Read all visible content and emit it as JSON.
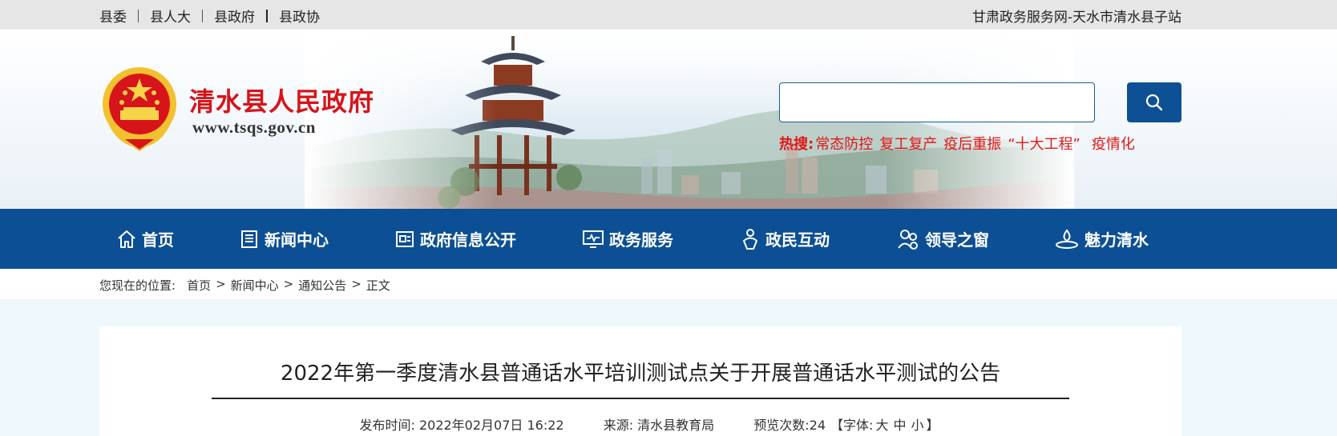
{
  "topbar": {
    "links": [
      "县委",
      "县人大",
      "县政府",
      "县政协"
    ],
    "site_name": "甘肃政务服务网-天水市清水县子站"
  },
  "header": {
    "gov_name": "清水县人民政府",
    "url": "www.tsqs.gov.cn",
    "search": {
      "placeholder": "",
      "value": ""
    },
    "hot": {
      "label": "热搜:",
      "items": [
        "常态防控",
        "复工复产",
        "疫后重振",
        "“十大工程”",
        "疫情化"
      ]
    }
  },
  "nav": {
    "items": [
      {
        "label": "首页",
        "icon": "home-icon"
      },
      {
        "label": "新闻中心",
        "icon": "newspaper-icon"
      },
      {
        "label": "政府信息公开",
        "icon": "info-board-icon"
      },
      {
        "label": "政务服务",
        "icon": "monitor-icon"
      },
      {
        "label": "政民互动",
        "icon": "interaction-icon"
      },
      {
        "label": "领导之窗",
        "icon": "people-icon"
      },
      {
        "label": "魅力清水",
        "icon": "water-drop-icon"
      }
    ]
  },
  "breadcrumb": {
    "prefix": "您现在的位置:",
    "items": [
      "首页",
      "新闻中心",
      "通知公告",
      "正文"
    ],
    "separator": ">"
  },
  "article": {
    "title": "2022年第一季度清水县普通话水平培训测试点关于开展普通话水平测试的公告",
    "publish_time": "发布时间: 2022年02月07日 16:22",
    "source": "来源: 清水县教育局",
    "views": "预览次数:24",
    "font_label_open": "【字体:",
    "font_large": "大",
    "font_medium": "中",
    "font_small": "小",
    "font_label_close": "】"
  },
  "colors": {
    "nav_bg": "#0c4f94",
    "accent_red": "#d7141a",
    "hot_red": "#e01818",
    "page_bg": "#eef7fc"
  }
}
